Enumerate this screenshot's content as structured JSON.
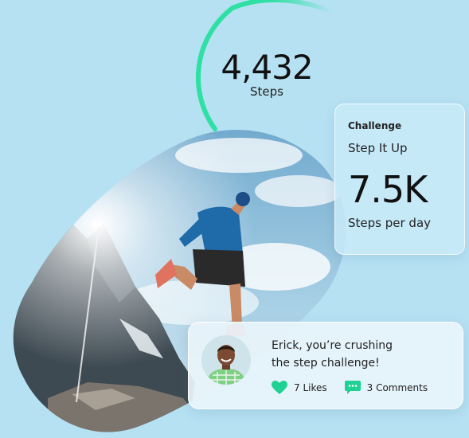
{
  "steps": {
    "value": "4,432",
    "label": "Steps",
    "ring_progress": 0.5
  },
  "challenge": {
    "title": "Challenge",
    "name": "Step It Up",
    "value": "7.5K",
    "unit": "Steps per day"
  },
  "comment": {
    "line1": "Erick, you’re crushing",
    "line2": "the step challenge!",
    "likes_label": "7 Likes",
    "comments_label": "3 Comments"
  },
  "colors": {
    "background": "#b6e1f3",
    "ring_accent": "#2ee0a3",
    "icon_accent": "#1fd192"
  }
}
